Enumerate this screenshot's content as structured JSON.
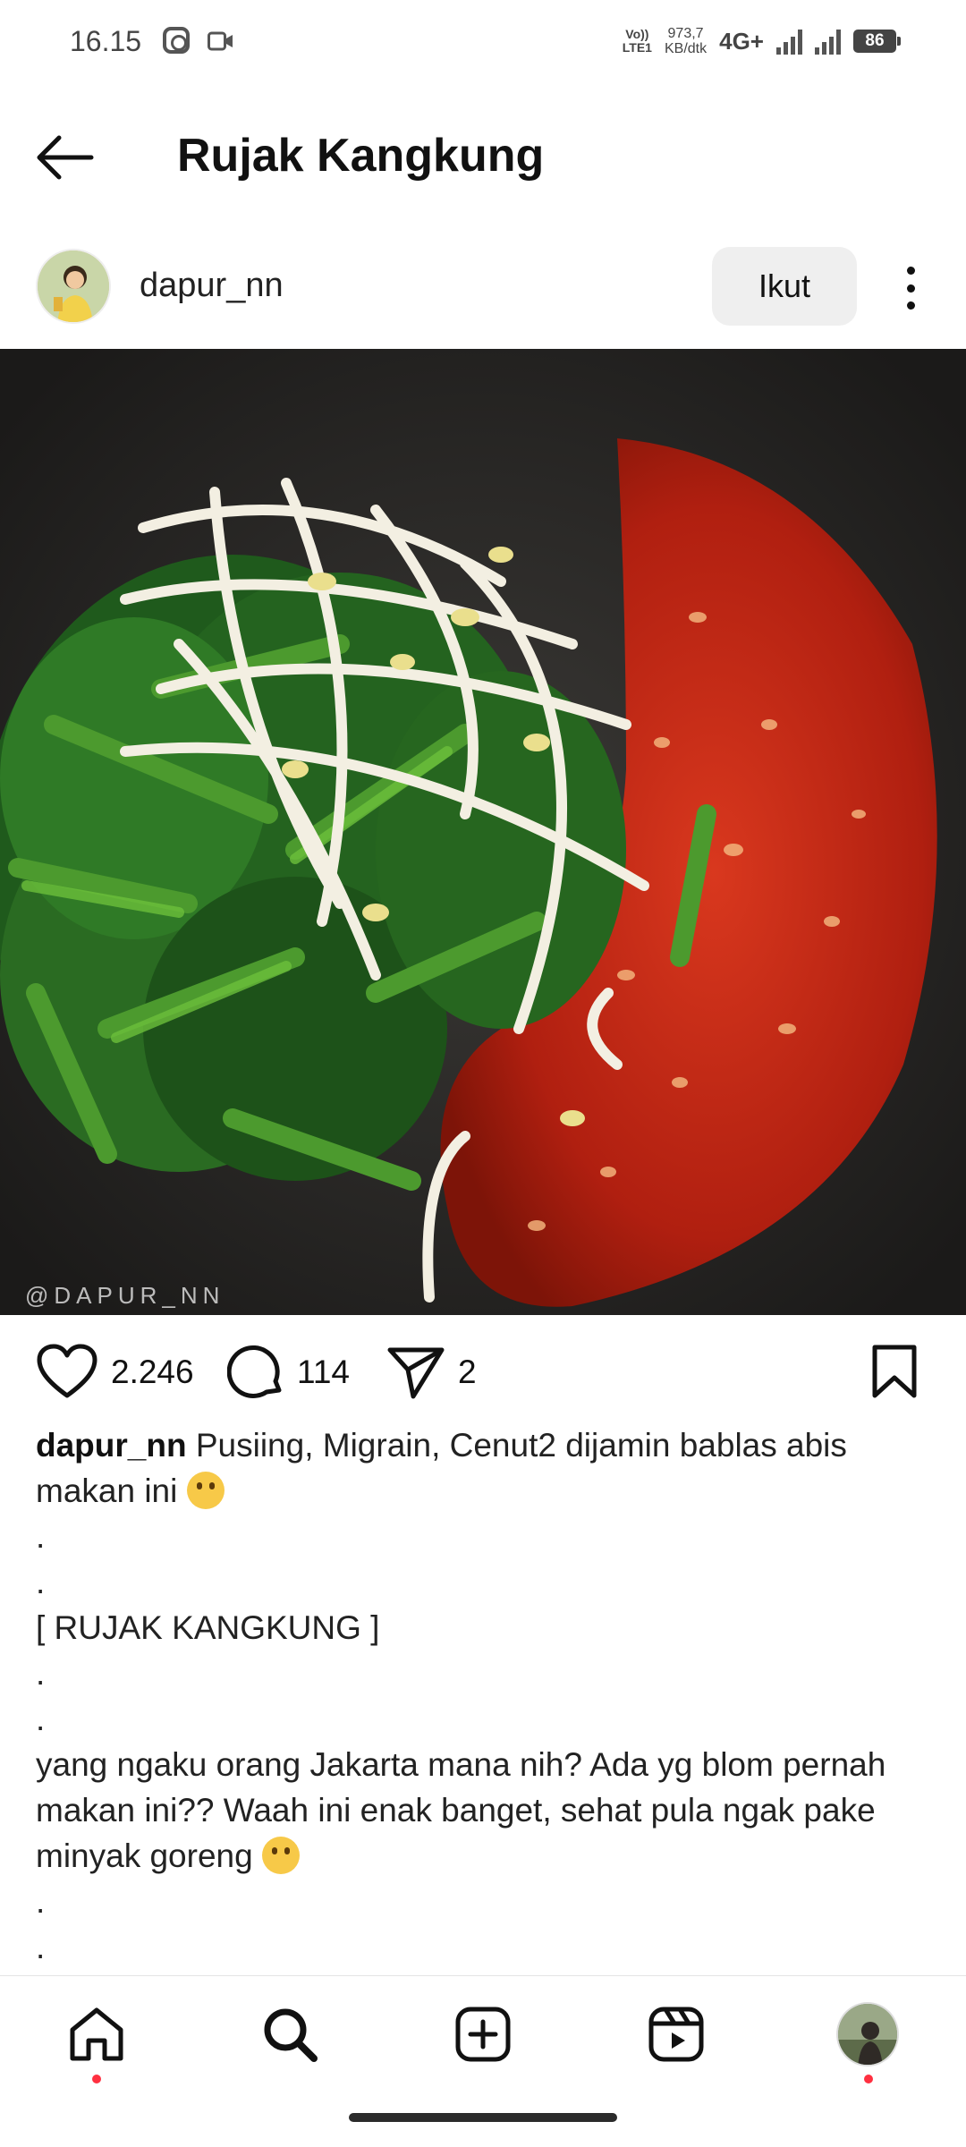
{
  "status_bar": {
    "time": "16.15",
    "volte": "Vo))\nLTE1",
    "speed_value": "973,7",
    "speed_unit": "KB/dtk",
    "network": "4G+",
    "battery": "86"
  },
  "header": {
    "title": "Rujak Kangkung"
  },
  "post": {
    "username": "dapur_nn",
    "follow_label": "Ikut",
    "watermark": "@DAPUR_NN",
    "likes": "2.246",
    "comments": "114",
    "shares": "2",
    "caption": {
      "username": "dapur_nn",
      "line1": "Pusiing, Migrain, Cenut2 dijamin bablas abis makan ini",
      "dot": ".",
      "heading": "[ RUJAK KANGKUNG ]",
      "body": "yang ngaku orang Jakarta mana nih? Ada yg blom pernah makan ini?? Waah ini enak banget, sehat pula ngak pake minyak goreng"
    }
  },
  "icons": {
    "back": "arrow-left-icon",
    "more": "more-vertical-icon",
    "like": "heart-icon",
    "comment": "comment-icon",
    "share": "send-icon",
    "save": "bookmark-icon",
    "nav": [
      "home-icon",
      "search-icon",
      "add-icon",
      "reels-icon",
      "profile-avatar"
    ]
  },
  "colors": {
    "notification_dot": "#ff3040",
    "follow_button_bg": "#efefef"
  }
}
